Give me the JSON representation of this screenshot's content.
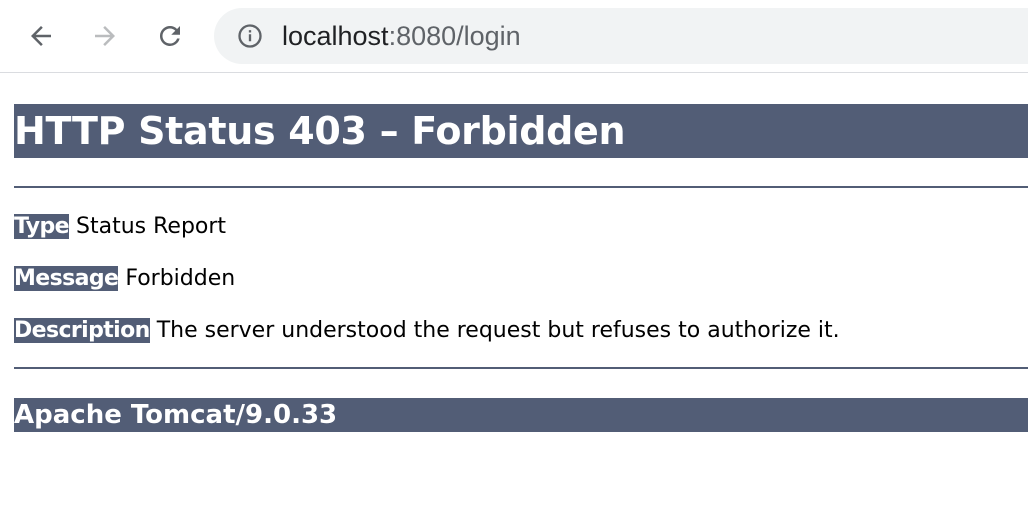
{
  "browser": {
    "url_host": "localhost",
    "url_rest": ":8080/login"
  },
  "page": {
    "title": "HTTP Status 403 – Forbidden",
    "type_label": "Type",
    "type_value": "Status Report",
    "message_label": "Message",
    "message_value": "Forbidden",
    "description_label": "Description",
    "description_value": "The server understood the request but refuses to authorize it.",
    "footer": "Apache Tomcat/9.0.33"
  },
  "colors": {
    "tomcat_header": "#525d76",
    "omnibox_bg": "#f1f3f4"
  },
  "icons": {
    "back": "arrow-left-icon",
    "forward": "arrow-right-icon",
    "reload": "reload-icon",
    "site_info": "info-icon"
  }
}
